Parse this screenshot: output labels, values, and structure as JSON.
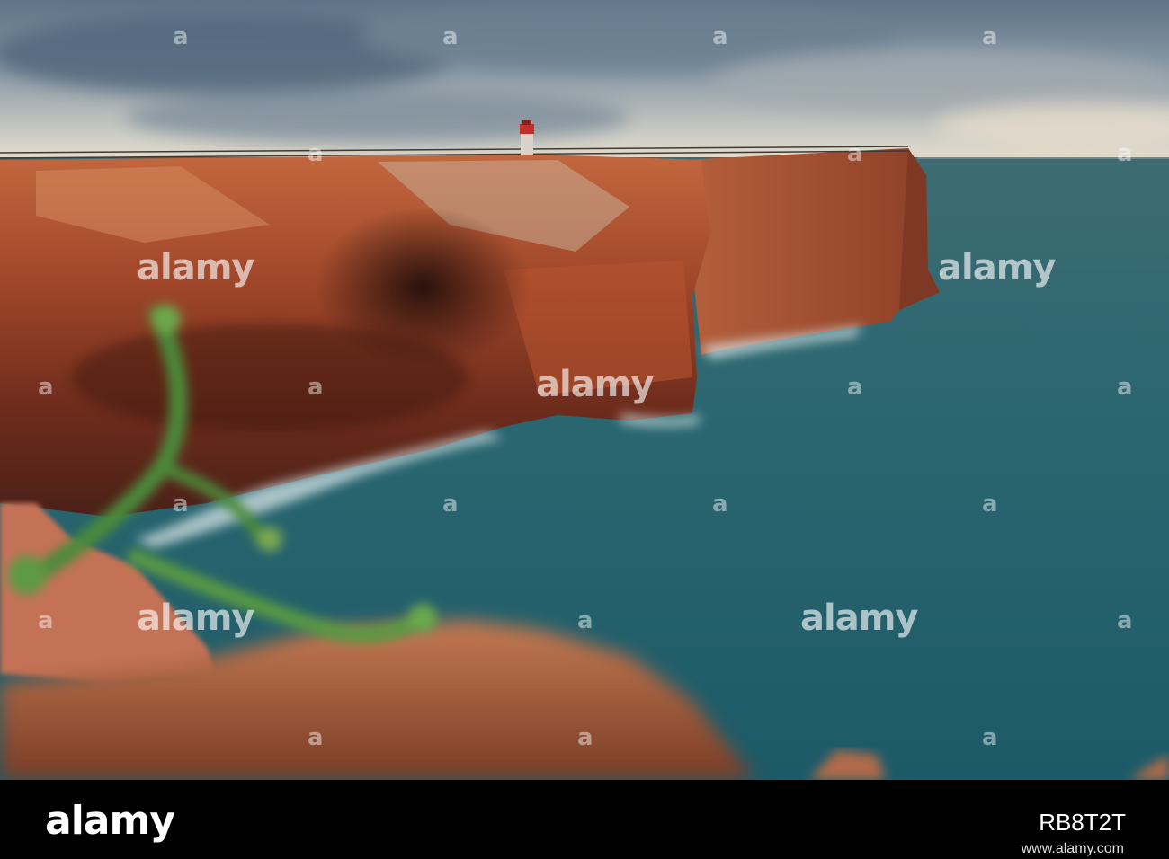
{
  "photo": {
    "subject": [
      "sky",
      "cliff",
      "lighthouse",
      "fence",
      "ocean",
      "waves",
      "plant",
      "foreground-rocks"
    ]
  },
  "watermark": {
    "text": "alamy",
    "small_text": "a"
  },
  "footer": {
    "logo": "alamy",
    "image_id": "RB8T2T",
    "url": "www.alamy.com"
  }
}
